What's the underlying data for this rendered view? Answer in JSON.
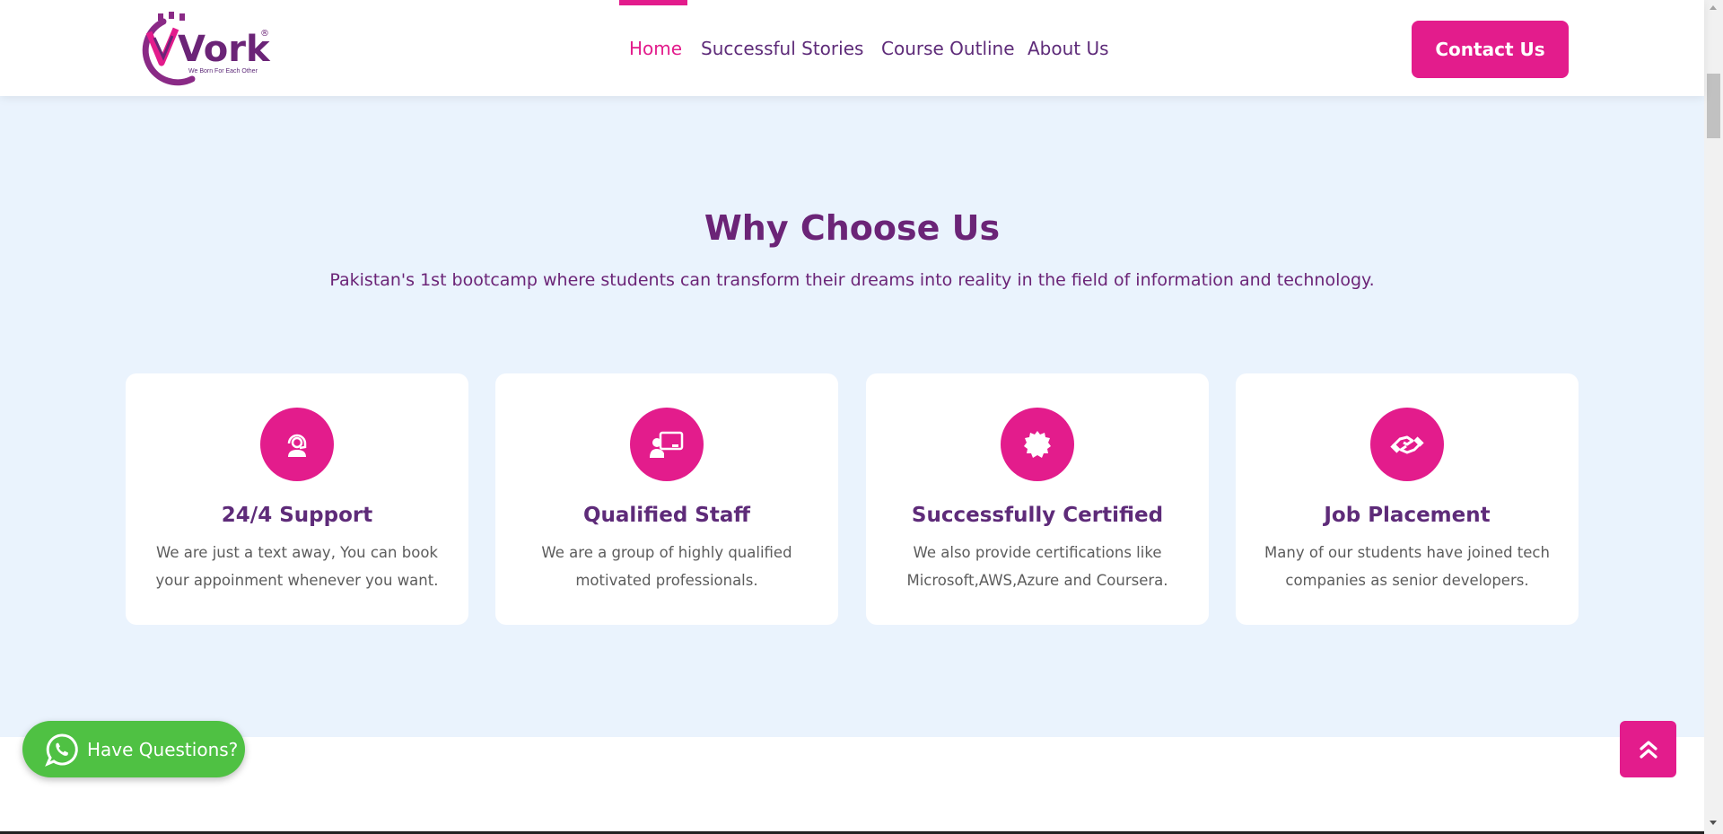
{
  "header": {
    "logo": {
      "text": "Vork",
      "tagline": "We Born For Each Other",
      "registered": "®"
    },
    "nav": [
      {
        "label": "Home",
        "active": true
      },
      {
        "label": "Successful Stories",
        "active": false
      },
      {
        "label": "Course Outline",
        "active": false
      },
      {
        "label": "About Us",
        "active": false
      }
    ],
    "contact_label": "Contact Us"
  },
  "why_choose": {
    "title": "Why Choose Us",
    "subtitle": "Pakistan's 1st bootcamp where students can transform their dreams into reality in the field of information and technology.",
    "cards": [
      {
        "icon": "support-agent-icon",
        "title": "24/4 Support",
        "text": "We are just a text away, You can book your appoinment whenever you want."
      },
      {
        "icon": "teacher-board-icon",
        "title": "Qualified Staff",
        "text": "We are a group of highly qualified motivated professionals."
      },
      {
        "icon": "certificate-badge-icon",
        "title": "Successfully Certified",
        "text": "We also provide certifications like Microsoft,AWS,Azure and Coursera."
      },
      {
        "icon": "handshake-icon",
        "title": "Job Placement",
        "text": "Many of our students have joined tech companies as senior developers."
      }
    ]
  },
  "whatsapp": {
    "label": "Have Questions?"
  },
  "colors": {
    "accent": "#e31c8c",
    "brand_purple": "#5e2b79",
    "section_bg": "#eaf3fd",
    "whatsapp_green": "#4fc143"
  }
}
